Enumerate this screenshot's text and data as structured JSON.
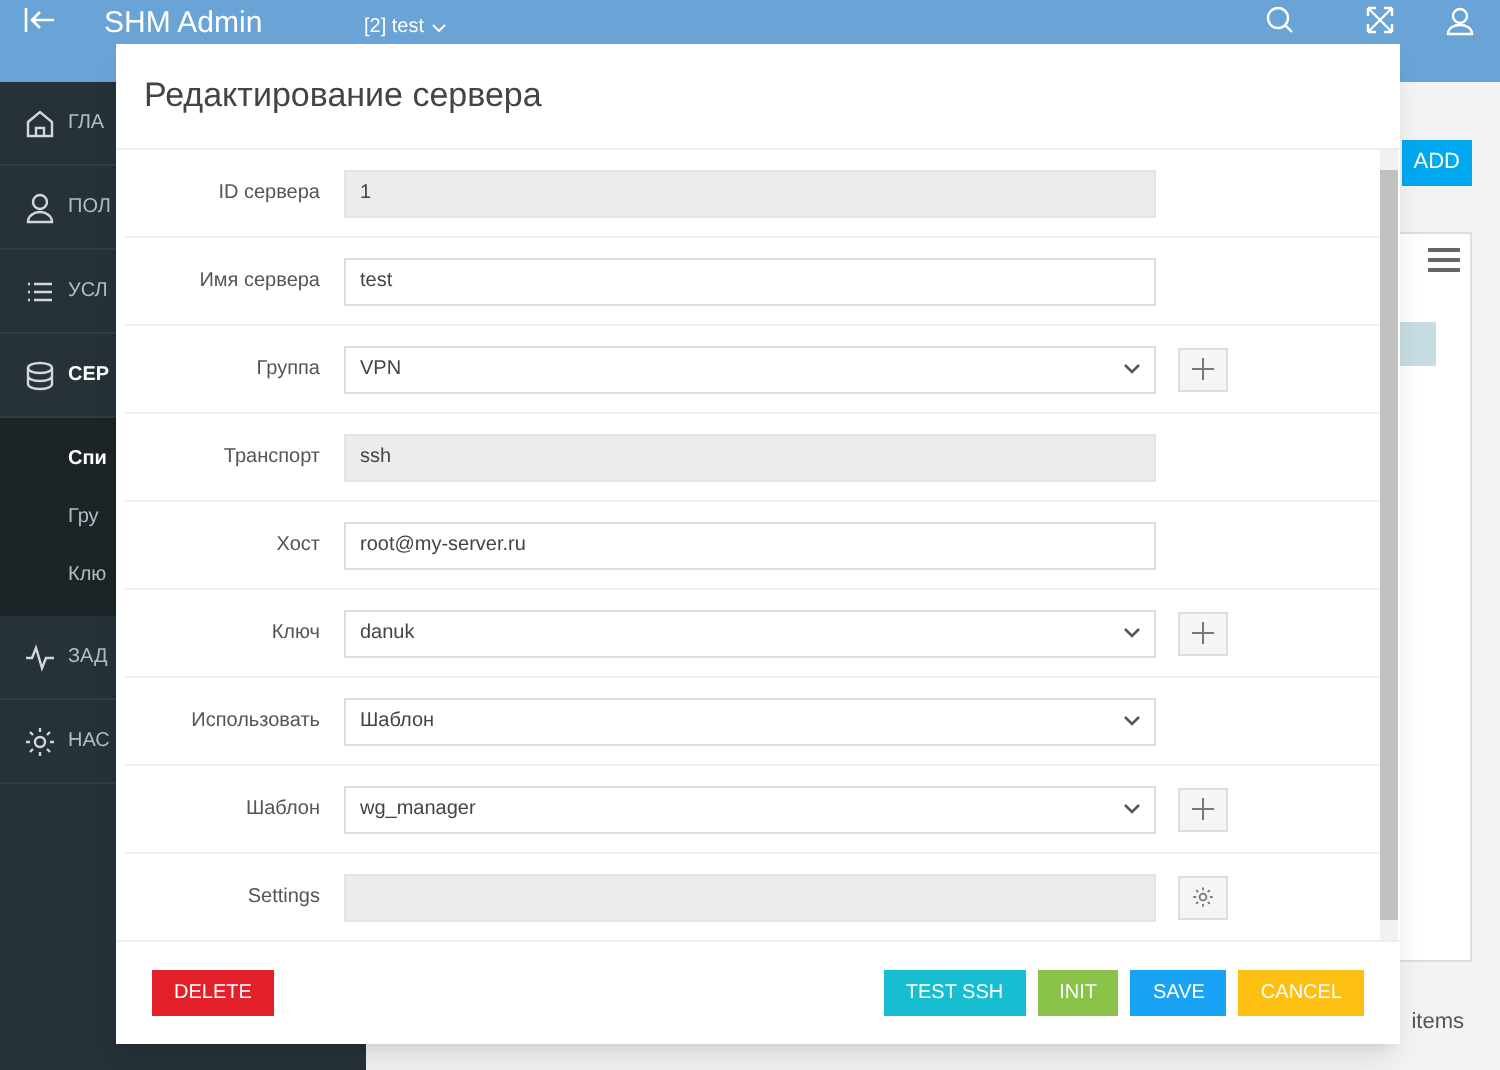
{
  "app": {
    "title": "SHM Admin",
    "context": "[2] test"
  },
  "sidebar": {
    "items": [
      {
        "label": "ГЛА",
        "kind": "main",
        "selected": false
      },
      {
        "label": "ПОЛ",
        "kind": "main",
        "selected": false
      },
      {
        "label": "УСЛ",
        "kind": "main",
        "selected": false
      },
      {
        "label": "СЕР",
        "kind": "main",
        "selected": true
      },
      {
        "label": "Спи",
        "kind": "sub",
        "selected": true
      },
      {
        "label": "Гру",
        "kind": "sub",
        "selected": false
      },
      {
        "label": "Клю",
        "kind": "sub",
        "selected": false
      },
      {
        "label": "ЗАД",
        "kind": "main",
        "selected": false
      },
      {
        "label": "НАС",
        "kind": "main",
        "selected": false
      }
    ]
  },
  "content": {
    "add_button": "ADD",
    "footer_text": "items"
  },
  "modal": {
    "title": "Редактирование сервера",
    "fields": [
      {
        "label": "ID сервера",
        "value": "1",
        "kind": "readonly"
      },
      {
        "label": "Имя сервера",
        "value": "test",
        "kind": "text"
      },
      {
        "label": "Группа",
        "value": "VPN",
        "kind": "select",
        "extra": {
          "kind": "plus"
        }
      },
      {
        "label": "Транспорт",
        "value": "ssh",
        "kind": "readonly"
      },
      {
        "label": "Хост",
        "value": "root@my-server.ru",
        "kind": "text"
      },
      {
        "label": "Ключ",
        "value": "danuk",
        "kind": "select",
        "extra": {
          "kind": "plus"
        }
      },
      {
        "label": "Использовать",
        "value": "Шаблон",
        "kind": "select"
      },
      {
        "label": "Шаблон",
        "value": "wg_manager",
        "kind": "select",
        "extra": {
          "kind": "plus"
        }
      },
      {
        "label": "Settings",
        "kind": "readonly",
        "extra": {
          "kind": "gear"
        }
      }
    ],
    "left_buttons": [
      {
        "label": "DELETE",
        "color": "#e3202a"
      }
    ],
    "right_buttons": [
      {
        "label": "TEST SSH",
        "color": "#17bed0"
      },
      {
        "label": "INIT",
        "color": "#8bc34a"
      },
      {
        "label": "SAVE",
        "color": "#1aa3f5"
      },
      {
        "label": "CANCEL",
        "color": "#fdc012"
      }
    ]
  }
}
